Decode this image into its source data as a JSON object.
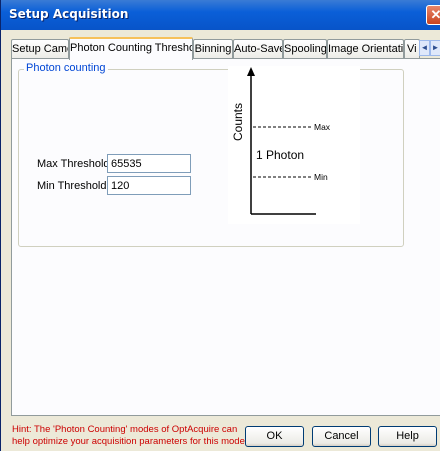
{
  "window": {
    "title": "Setup Acquisition",
    "close_glyph": "✕"
  },
  "tabs": [
    {
      "label": "Setup Camera"
    },
    {
      "label": "Photon Counting Threshold"
    },
    {
      "label": "Binning"
    },
    {
      "label": "Auto-Save"
    },
    {
      "label": "Spooling"
    },
    {
      "label": "Image Orientation"
    },
    {
      "label": "Vi"
    }
  ],
  "tab_scroll": {
    "left_glyph": "◄",
    "right_glyph": "►"
  },
  "group": {
    "title": "Photon counting"
  },
  "fields": {
    "max_threshold": {
      "label": "Max Threshold",
      "value": "65535"
    },
    "min_threshold": {
      "label": "Min Threshold",
      "value": "120"
    }
  },
  "diagram": {
    "y_axis_label": "Counts",
    "center_label": "1 Photon",
    "max_label": "Max",
    "min_label": "Min"
  },
  "hint": "Hint: The 'Photon Counting' modes of OptAcquire can help optimize your acquisition parameters for this mode",
  "buttons": {
    "ok": "OK",
    "cancel": "Cancel",
    "help": "Help"
  }
}
